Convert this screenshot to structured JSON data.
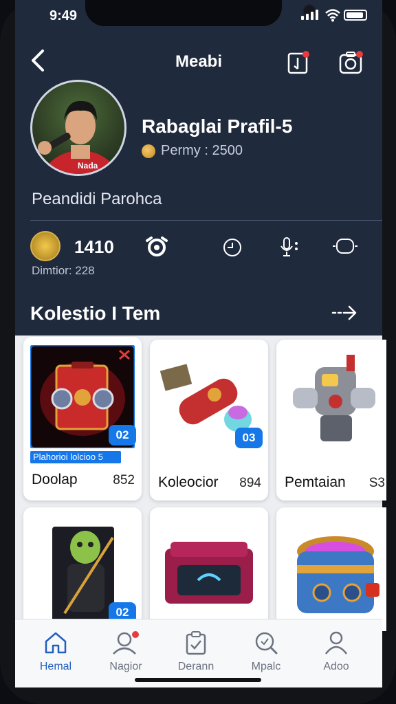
{
  "status_bar": {
    "time": "9:49"
  },
  "header": {
    "title": "Meabi"
  },
  "profile": {
    "name": "Rabaglai Prafil-5",
    "coins_text": "Permy : 2500",
    "subtitle": "Peandidi Parohca"
  },
  "stats": {
    "count": "1410",
    "sub_label": "Dimtior: 228"
  },
  "collection": {
    "title": "Kolestio I Tem",
    "cards": [
      {
        "name": "Doolap",
        "price": "852",
        "qty": "02",
        "banner": "Plahorioi lolcioo 5"
      },
      {
        "name": "Koleocior",
        "price": "894",
        "qty": "03"
      },
      {
        "name": "Pemtaian",
        "price": "S3"
      },
      {
        "qty": "02"
      },
      {},
      {}
    ]
  },
  "tabs": [
    {
      "label": "Hemal",
      "icon": "home-icon",
      "active": true
    },
    {
      "label": "Nagior",
      "icon": "user-icon"
    },
    {
      "label": "Derann",
      "icon": "clipboard-check-icon"
    },
    {
      "label": "Mpalc",
      "icon": "search-icon"
    },
    {
      "label": "Adoo",
      "icon": "person-icon"
    }
  ],
  "colors": {
    "accent": "#1677e8",
    "background": "#1f2a3d",
    "notification": "#e83b3b"
  }
}
